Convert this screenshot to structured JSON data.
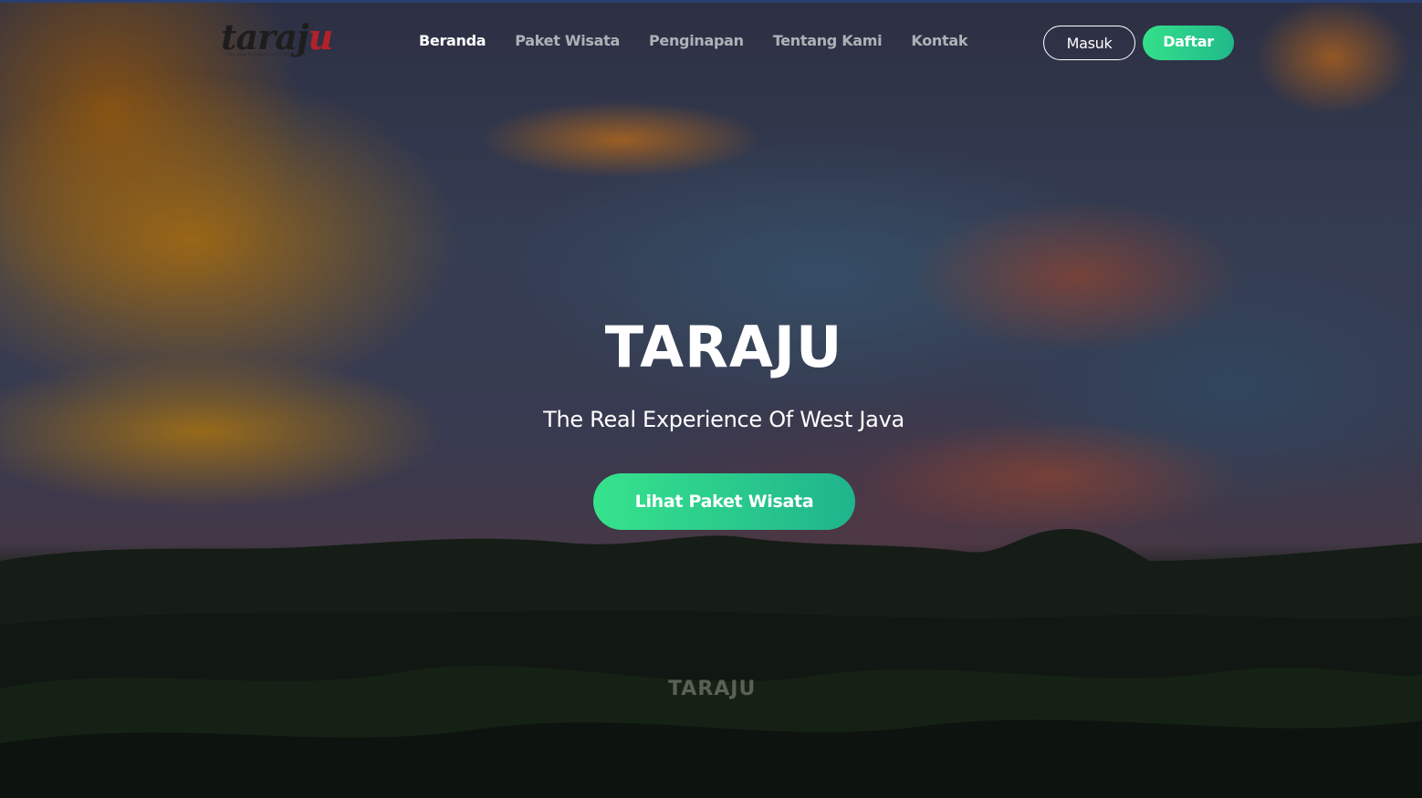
{
  "brand": {
    "logo_text_main": "taraj",
    "logo_text_accent": "u",
    "logo_tagline": "The Real Experience Of West Java"
  },
  "nav": {
    "links": [
      {
        "label": "Beranda",
        "active": true
      },
      {
        "label": "Paket Wisata",
        "active": false
      },
      {
        "label": "Penginapan",
        "active": false
      },
      {
        "label": "Tentang Kami",
        "active": false
      },
      {
        "label": "Kontak",
        "active": false
      }
    ],
    "login_label": "Masuk",
    "register_label": "Daftar"
  },
  "hero": {
    "title": "TARAJU",
    "subtitle": "The Real Experience Of West Java",
    "cta_label": "Lihat Paket Wisata",
    "sign_text": "TARAJU"
  },
  "colors": {
    "accent_start": "#34e08a",
    "accent_end": "#1fb48c",
    "text": "#ffffff",
    "logo_red": "#b3212b"
  }
}
